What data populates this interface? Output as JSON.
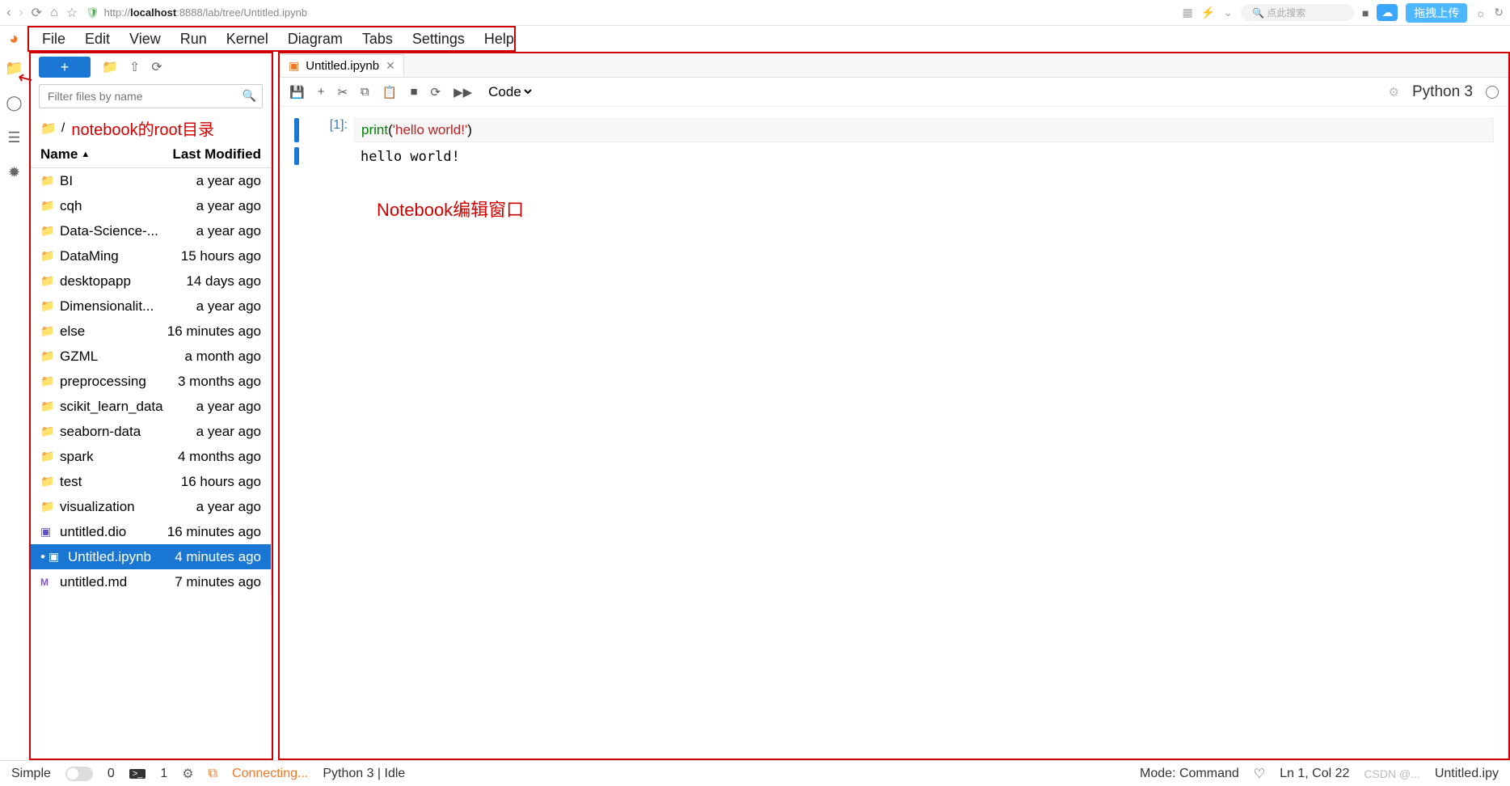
{
  "browser": {
    "url_prefix": "http://",
    "url_host": "localhost",
    "url_port_path": ":8888/lab/tree/Untitled.ipynb",
    "search_placeholder": "点此搜索",
    "upload_label": "拖拽上传"
  },
  "menu": {
    "items": [
      "File",
      "Edit",
      "View",
      "Run",
      "Kernel",
      "Diagram",
      "Tabs",
      "Settings",
      "Help"
    ]
  },
  "filebrowser": {
    "filter_placeholder": "Filter files by name",
    "crumb_sep": "/",
    "annotation_root": "notebook的root目录",
    "header_name": "Name",
    "header_modified": "Last Modified",
    "items": [
      {
        "icon": "folder",
        "name": "BI",
        "modified": "a year ago"
      },
      {
        "icon": "folder",
        "name": "cqh",
        "modified": "a year ago"
      },
      {
        "icon": "folder",
        "name": "Data-Science-...",
        "modified": "a year ago"
      },
      {
        "icon": "folder",
        "name": "DataMing",
        "modified": "15 hours ago"
      },
      {
        "icon": "folder",
        "name": "desktopapp",
        "modified": "14 days ago"
      },
      {
        "icon": "folder",
        "name": "Dimensionalit...",
        "modified": "a year ago"
      },
      {
        "icon": "folder",
        "name": "else",
        "modified": "16 minutes ago"
      },
      {
        "icon": "folder",
        "name": "GZML",
        "modified": "a month ago"
      },
      {
        "icon": "folder",
        "name": "preprocessing",
        "modified": "3 months ago"
      },
      {
        "icon": "folder",
        "name": "scikit_learn_data",
        "modified": "a year ago"
      },
      {
        "icon": "folder",
        "name": "seaborn-data",
        "modified": "a year ago"
      },
      {
        "icon": "folder",
        "name": "spark",
        "modified": "4 months ago"
      },
      {
        "icon": "folder",
        "name": "test",
        "modified": "16 hours ago"
      },
      {
        "icon": "folder",
        "name": "visualization",
        "modified": "a year ago"
      },
      {
        "icon": "dio",
        "name": "untitled.dio",
        "modified": "16 minutes ago"
      },
      {
        "icon": "nb",
        "name": "Untitled.ipynb",
        "modified": "4 minutes ago",
        "selected": true,
        "dirty": true
      },
      {
        "icon": "md",
        "name": "untitled.md",
        "modified": "7 minutes ago"
      }
    ]
  },
  "notebook": {
    "tab_title": "Untitled.ipynb",
    "cell_type_label": "Code",
    "kernel_name": "Python 3",
    "annotation_editor": "Notebook编辑窗口",
    "cell": {
      "prompt": "[1]:",
      "code_func": "print",
      "code_paren_open": "(",
      "code_string": "'hello world!'",
      "code_paren_close": ")",
      "output": "hello world!"
    }
  },
  "status": {
    "simple": "Simple",
    "tabs_count": "0",
    "terminals_count": "1",
    "connecting": "Connecting...",
    "kernel_status": "Python 3 | Idle",
    "mode": "Mode: Command",
    "cursor": "Ln 1, Col 22",
    "filename": "Untitled.ipy",
    "watermark": "CSDN @..."
  }
}
